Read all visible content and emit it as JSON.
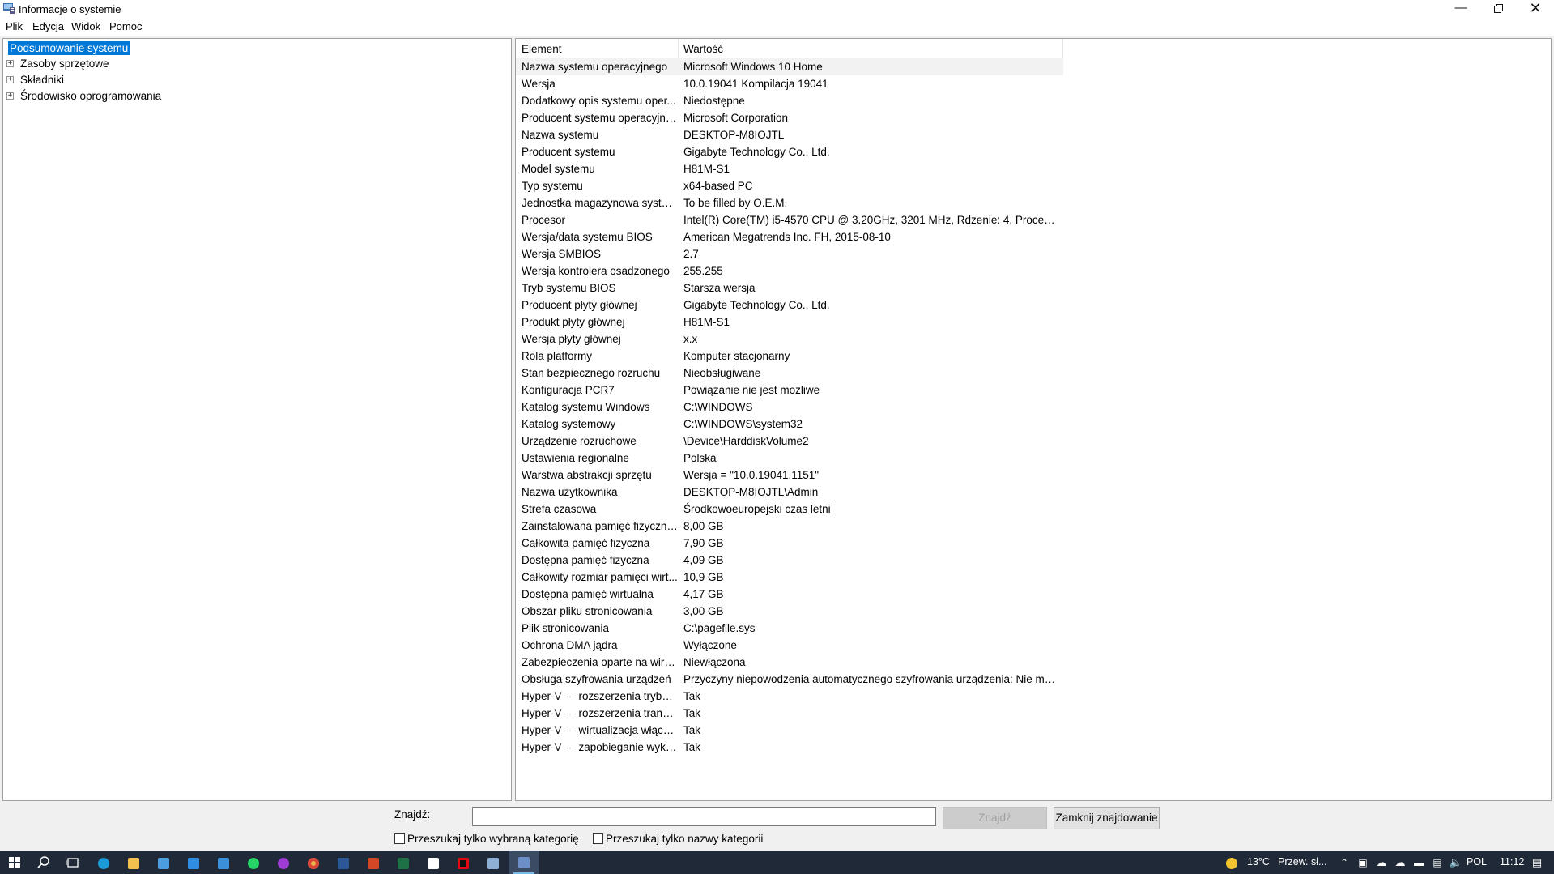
{
  "window": {
    "title": "Informacje o systemie"
  },
  "menu": [
    "Plik",
    "Edycja",
    "Widok",
    "Pomoc"
  ],
  "tree": {
    "root": "Podsumowanie systemu",
    "children": [
      "Zasoby sprzętowe",
      "Składniki",
      "Środowisko oprogramowania"
    ]
  },
  "table": {
    "columns": [
      "Element",
      "Wartość"
    ],
    "rows": [
      [
        "Nazwa systemu operacyjnego",
        "Microsoft Windows 10 Home"
      ],
      [
        "Wersja",
        "10.0.19041 Kompilacja 19041"
      ],
      [
        "Dodatkowy opis systemu oper...",
        "Niedostępne"
      ],
      [
        "Producent systemu operacyjne...",
        "Microsoft Corporation"
      ],
      [
        "Nazwa systemu",
        "DESKTOP-M8IOJTL"
      ],
      [
        "Producent systemu",
        "Gigabyte Technology Co., Ltd."
      ],
      [
        "Model systemu",
        "H81M-S1"
      ],
      [
        "Typ systemu",
        "x64-based PC"
      ],
      [
        "Jednostka magazynowa systemu",
        "To be filled by O.E.M."
      ],
      [
        "Procesor",
        "Intel(R) Core(TM) i5-4570 CPU @ 3.20GHz, 3201 MHz, Rdzenie: 4, Procesory l..."
      ],
      [
        "Wersja/data systemu BIOS",
        "American Megatrends Inc. FH, 2015-08-10"
      ],
      [
        "Wersja SMBIOS",
        "2.7"
      ],
      [
        "Wersja kontrolera osadzonego",
        "255.255"
      ],
      [
        "Tryb systemu BIOS",
        "Starsza wersja"
      ],
      [
        "Producent płyty głównej",
        "Gigabyte Technology Co., Ltd."
      ],
      [
        "Produkt płyty głównej",
        "H81M-S1"
      ],
      [
        "Wersja płyty głównej",
        "x.x"
      ],
      [
        "Rola platformy",
        "Komputer stacjonarny"
      ],
      [
        "Stan bezpiecznego rozruchu",
        "Nieobsługiwane"
      ],
      [
        "Konfiguracja PCR7",
        "Powiązanie nie jest możliwe"
      ],
      [
        "Katalog systemu Windows",
        "C:\\WINDOWS"
      ],
      [
        "Katalog systemowy",
        "C:\\WINDOWS\\system32"
      ],
      [
        "Urządzenie rozruchowe",
        "\\Device\\HarddiskVolume2"
      ],
      [
        "Ustawienia regionalne",
        "Polska"
      ],
      [
        "Warstwa abstrakcji sprzętu",
        "Wersja = \"10.0.19041.1151\""
      ],
      [
        "Nazwa użytkownika",
        "DESKTOP-M8IOJTL\\Admin"
      ],
      [
        "Strefa czasowa",
        "Środkowoeuropejski czas letni"
      ],
      [
        "Zainstalowana pamięć fizyczna ...",
        "8,00 GB"
      ],
      [
        "Całkowita pamięć fizyczna",
        "7,90 GB"
      ],
      [
        "Dostępna pamięć fizyczna",
        "4,09 GB"
      ],
      [
        "Całkowity rozmiar pamięci wirt...",
        "10,9 GB"
      ],
      [
        "Dostępna pamięć wirtualna",
        "4,17 GB"
      ],
      [
        "Obszar pliku stronicowania",
        "3,00 GB"
      ],
      [
        "Plik stronicowania",
        "C:\\pagefile.sys"
      ],
      [
        "Ochrona DMA jądra",
        "Wyłączone"
      ],
      [
        "Zabezpieczenia oparte na wirtu...",
        "Niewłączona"
      ],
      [
        "Obsługa szyfrowania urządzeń",
        "Przyczyny niepowodzenia automatycznego szyfrowania urządzenia: Nie możn..."
      ],
      [
        "Hyper-V — rozszerzenia trybu ...",
        "Tak"
      ],
      [
        "Hyper-V — rozszerzenia transl...",
        "Tak"
      ],
      [
        "Hyper-V — wirtualizacja włączo...",
        "Tak"
      ],
      [
        "Hyper-V — zapobieganie wyko...",
        "Tak"
      ]
    ]
  },
  "find": {
    "label": "Znajdź:",
    "value": "",
    "find_button": "Znajdź",
    "close_button": "Zamknij znajdowanie",
    "check_selected": "Przeszukaj tylko wybraną kategorię",
    "check_names": "Przeszukaj tylko nazwy kategorii"
  },
  "taskbar": {
    "weather": "13°C",
    "weather_desc": "Przew. sł...",
    "language": "POL",
    "time": "11:12"
  },
  "colors": {
    "selection": "#0078d7",
    "taskbar": "#1f2937"
  }
}
